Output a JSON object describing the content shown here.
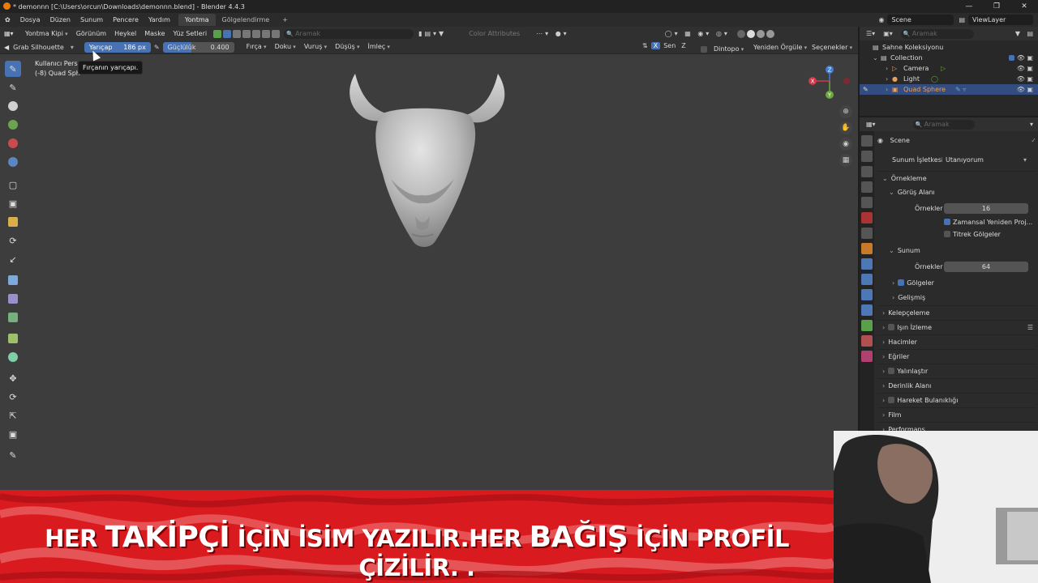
{
  "window": {
    "title": "* demonnn [C:\\Users\\orcun\\Downloads\\demonnn.blend] - Blender 4.4.3",
    "controls": [
      "—",
      "❐",
      "✕"
    ]
  },
  "menubar": {
    "items": [
      "Dosya",
      "Düzen",
      "Sunum",
      "Pencere",
      "Yardım"
    ],
    "workspaces": [
      "Yontma",
      "Gölgelendirme",
      "+"
    ],
    "scene": "Scene",
    "view_layer": "ViewLayer"
  },
  "header": {
    "mode": "Yontma Kipi",
    "menus": [
      "Görünüm",
      "Heykel",
      "Maske",
      "Yüz Setleri"
    ],
    "search_placeholder": "Aramak",
    "color_attributes": "Color Attributes"
  },
  "tool_header": {
    "brush": "Grab Silhouette",
    "radius_label": "Yarıçap",
    "radius_value": "186 px",
    "strength_label": "Güçlülük",
    "strength_value": "0.400",
    "menus": [
      "Fırça",
      "Doku",
      "Vuruş",
      "Düşüş",
      "İmleç"
    ],
    "symmetry_x": "X",
    "symmetry_label": "Sen",
    "symmetry_z": "Z",
    "dyntopo": "Dintopo",
    "remesh": "Yeniden Örgüle",
    "options": "Seçenekler"
  },
  "viewport": {
    "info_line1": "Kullanıcı Persp",
    "info_line2": "(-8) Quad Sph",
    "tooltip": "Fırçanın yarıçapı.",
    "gizmo": {
      "x": "X",
      "y": "Y",
      "z": "Z"
    }
  },
  "outliner": {
    "search_placeholder": "Aramak",
    "root": "Sahne Koleksiyonu",
    "collection": "Collection",
    "items": [
      "Camera",
      "Light",
      "Quad Sphere"
    ]
  },
  "properties": {
    "search_placeholder": "Aramak",
    "scene": "Scene",
    "render_engine_label": "Sunum İşletkesi",
    "render_engine_value": "Utanıyorum",
    "sampling": "Örnekleme",
    "viewport": "Görüş Alanı",
    "samples_label": "Örnekler",
    "viewport_samples": "16",
    "temporal_reprojection": "Zamansal Yeniden Proj...",
    "jitter_shadows": "Titrek Gölgeler",
    "render": "Sunum",
    "render_samples": "64",
    "shadows": "Gölgeler",
    "advanced": "Gelişmiş",
    "panels": [
      "Kelepçeleme",
      "Işın İzleme",
      "Hacimler",
      "Eğriler",
      "Yalınlaştır",
      "Derinlik Alanı",
      "Hareket Bulanıklığı",
      "Film",
      "Performans"
    ]
  },
  "banner": {
    "parts": [
      "HER ",
      "TAKİPÇİ",
      " İÇİN İSİM YAZILIR.HER ",
      "BAĞIŞ",
      " İÇİN PROFİL ÇİZİLİR.",
      "  ."
    ]
  },
  "colors": {
    "accent_blue": "#4772b3",
    "selection": "#334d80",
    "banner_red": "#d91a1f",
    "viewport_bg": "#3d3d3d",
    "blender_orange": "#e87d0d"
  }
}
